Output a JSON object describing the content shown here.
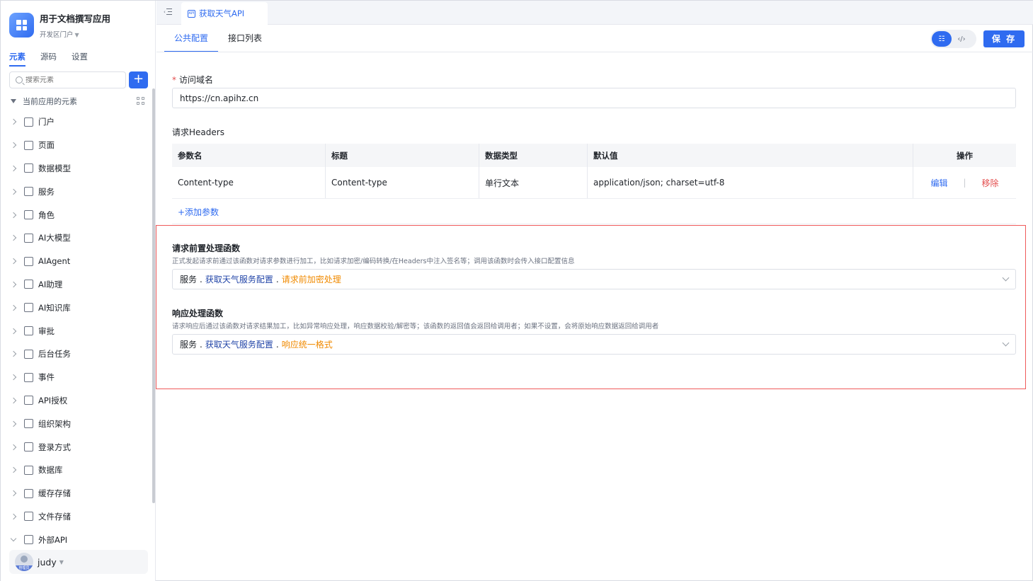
{
  "app": {
    "title": "用于文档撰写应用",
    "portal": "开发区门户"
  },
  "sidebar": {
    "tabs": [
      {
        "label": "元素"
      },
      {
        "label": "源码"
      },
      {
        "label": "设置"
      }
    ],
    "search_placeholder": "搜索元素",
    "tree_root_label": "当前应用的元素",
    "items": [
      {
        "label": "门户",
        "icon": "home-icon"
      },
      {
        "label": "页面",
        "icon": "page-icon"
      },
      {
        "label": "数据模型",
        "icon": "table-icon"
      },
      {
        "label": "服务",
        "icon": "service-icon"
      },
      {
        "label": "角色",
        "icon": "role-icon"
      },
      {
        "label": "AI大模型",
        "icon": "cube-icon"
      },
      {
        "label": "AIAgent",
        "icon": "robot-icon"
      },
      {
        "label": "AI助理",
        "icon": "ai-icon"
      },
      {
        "label": "AI知识库",
        "icon": "book-icon"
      },
      {
        "label": "审批",
        "icon": "stamp-icon"
      },
      {
        "label": "后台任务",
        "icon": "task-icon"
      },
      {
        "label": "事件",
        "icon": "event-icon"
      },
      {
        "label": "API授权",
        "icon": "key-icon"
      },
      {
        "label": "组织架构",
        "icon": "org-icon"
      },
      {
        "label": "登录方式",
        "icon": "login-icon"
      },
      {
        "label": "数据库",
        "icon": "database-icon"
      },
      {
        "label": "缓存存储",
        "icon": "cache-icon"
      },
      {
        "label": "文件存储",
        "icon": "file-icon"
      },
      {
        "label": "外部API",
        "icon": "api-icon"
      }
    ],
    "user": {
      "name": "judy",
      "badge": "管理员"
    }
  },
  "topbar": {
    "tab_label": "获取天气API"
  },
  "content": {
    "tabs": [
      {
        "label": "公共配置"
      },
      {
        "label": "接口列表"
      }
    ],
    "save_label": "保 存",
    "domain": {
      "label": "访问域名",
      "value": "https://cn.apihz.cn"
    },
    "headers": {
      "label": "请求Headers",
      "columns": [
        "参数名",
        "标题",
        "数据类型",
        "默认值",
        "操作"
      ],
      "rows": [
        {
          "name": "Content-type",
          "title": "Content-type",
          "type": "单行文本",
          "default": "application/json; charset=utf-8",
          "edit": "编辑",
          "remove": "移除"
        }
      ],
      "add_label": "+添加参数"
    },
    "pre_fn": {
      "title": "请求前置处理函数",
      "desc": "正式发起请求前通过该函数对请求参数进行加工，比如请求加密/编码转换/在Headers中注入签名等；调用该函数时会传入接口配置信息",
      "service": "服务",
      "config": "获取天气服务配置",
      "fn": "请求前加密处理"
    },
    "resp_fn": {
      "title": "响应处理函数",
      "desc": "请求响应后通过该函数对请求结果加工，比如异常响应处理，响应数据校验/解密等；该函数的返回值会返回给调用者；如果不设置，会将原始响应数据返回给调用者",
      "service": "服务",
      "config": "获取天气服务配置",
      "fn": "响应统一格式"
    }
  },
  "colors": {
    "accent": "#2f6bf0",
    "danger": "#e34d4d",
    "highlight_border": "#ef5b5b",
    "function_name": "#f08a00"
  }
}
